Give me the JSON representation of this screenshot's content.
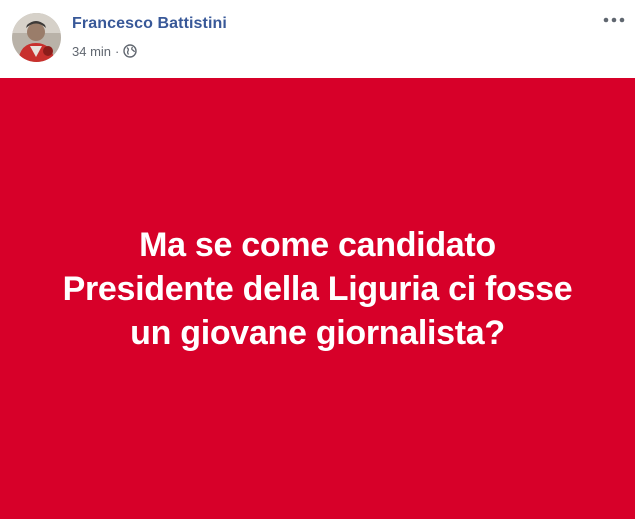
{
  "post": {
    "author_name": "Francesco Battistini",
    "timestamp": "34 min",
    "separator": "·",
    "privacy_icon": "globe-icon",
    "menu_icon": "more-options-icon",
    "avatar_icon": "profile-photo",
    "background_color": "#d70029",
    "text_color": "#ffffff",
    "status_lines": [
      "Ma se come candidato",
      "Presidente della Liguria ci fosse",
      "un giovane giornalista?"
    ]
  }
}
